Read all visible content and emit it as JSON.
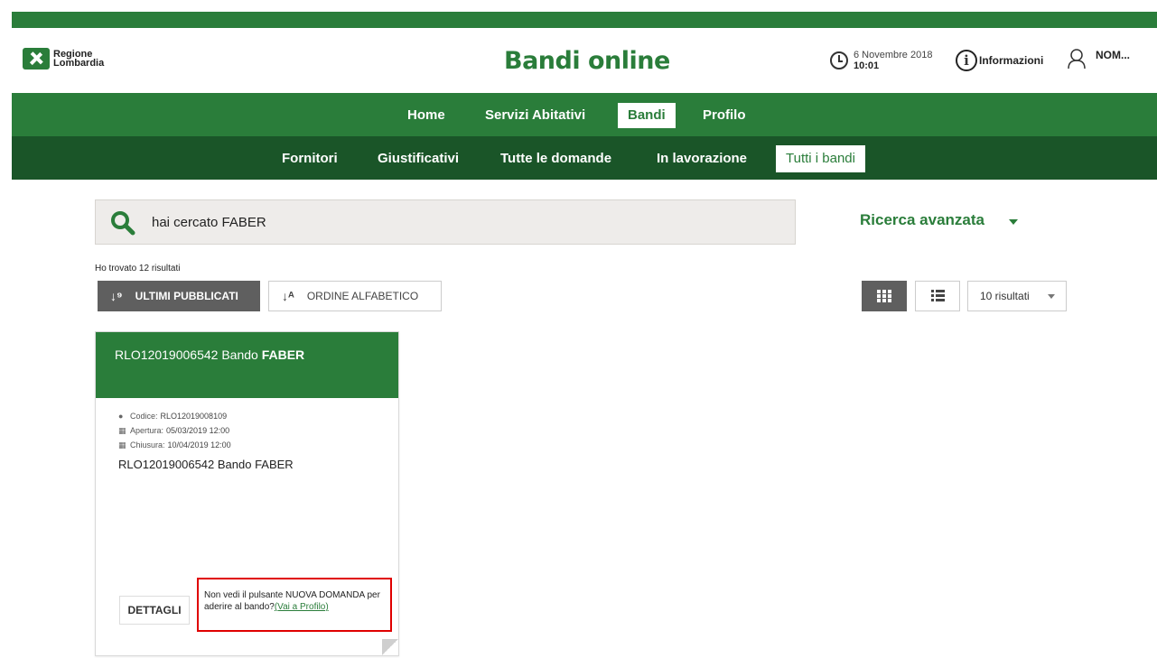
{
  "header": {
    "logo_line1": "Regione",
    "logo_line2": "Lombardia",
    "title": "Bandi online",
    "date": "6 Novembre 2018",
    "time": "10:01",
    "info_label": "Informazioni",
    "user_name": "NOM..."
  },
  "nav_main": {
    "items": [
      "Home",
      "Servizi Abitativi",
      "Bandi",
      "Profilo"
    ],
    "active": "Bandi"
  },
  "nav_sub": {
    "items": [
      "Fornitori",
      "Giustificativi",
      "Tutte le domande",
      "In lavorazione",
      "Tutti i bandi"
    ],
    "active": "Tutti i bandi"
  },
  "search": {
    "text": "hai cercato FABER",
    "advanced_label": "Ricerca avanzata"
  },
  "results": {
    "found_text": "Ho trovato 12 risultati",
    "sort_latest": "ULTIMI PUBBLICATI",
    "sort_alpha": "ORDINE ALFABETICO",
    "per_page": "10 risultati"
  },
  "card": {
    "title_prefix": "RLO12019006542 Bando ",
    "title_bold": "FABER",
    "code_label": "Codice:",
    "code_value": "RLO12019008109",
    "open_label": "Apertura:",
    "open_value": "05/03/2019 12:00",
    "close_label": "Chiusura:",
    "close_value": "10/04/2019 12:00",
    "description": "RLO12019006542 Bando FABER",
    "details_button": "DETTAGLI",
    "notice_text": "Non vedi il pulsante NUOVA DOMANDA per aderire al bando?",
    "notice_link": "(Vai a Profilo)"
  },
  "colors": {
    "brand_green": "#2a7d3a",
    "dark_green": "#1a5528",
    "highlight_red": "#e00000"
  }
}
